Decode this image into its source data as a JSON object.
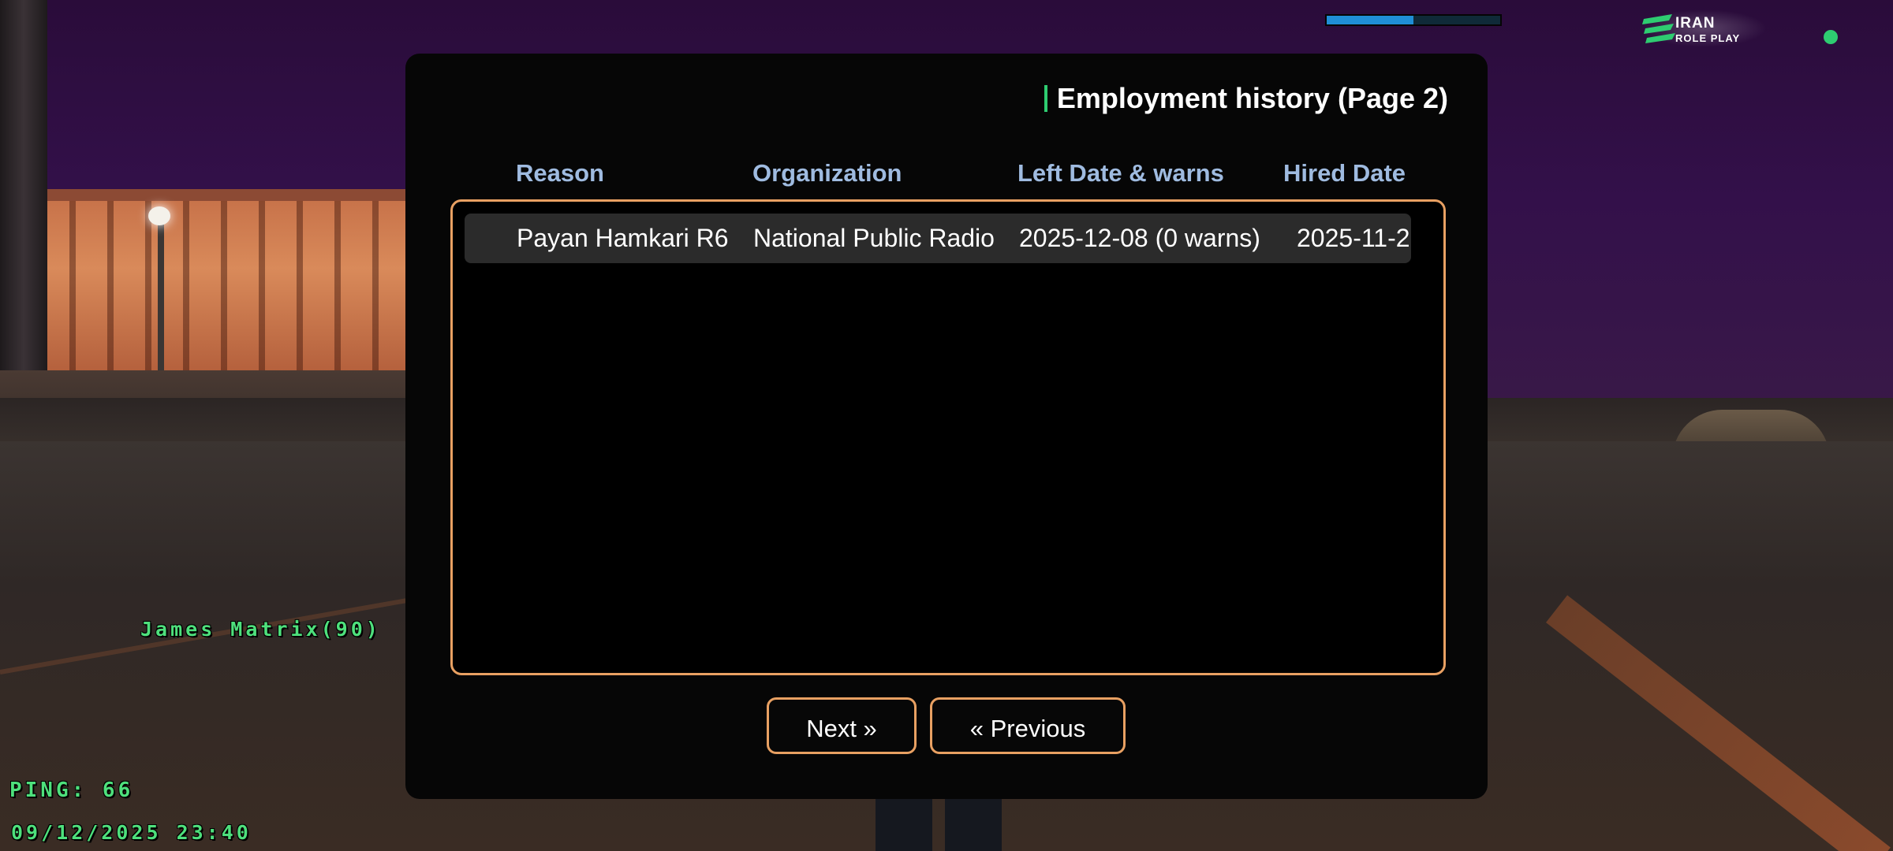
{
  "hud": {
    "player_name": "James Matrix(90)",
    "ping": "PING: 66",
    "datetime": "09/12/2025 23:40",
    "health_bar_fraction": 0.5,
    "status_color": "#2ecc71",
    "logo": {
      "line1": "IRAN",
      "line2": "ROLE PLAY"
    }
  },
  "dialog": {
    "title": "Employment history (Page 2)",
    "columns": {
      "reason": "Reason",
      "organization": "Organization",
      "left_date": "Left Date & warns",
      "hired_date": "Hired Date"
    },
    "rows": [
      {
        "reason": "Payan Hamkari R6",
        "organization": "National Public Radio",
        "left_date": "2025-12-08 (0 warns)",
        "hired_date": "2025-11-2"
      }
    ],
    "next_label": "Next »",
    "previous_label": "« Previous"
  },
  "colors": {
    "accent_border": "#e8a062",
    "header_text": "#9fbbe0",
    "hud_text": "#4ee07c"
  }
}
